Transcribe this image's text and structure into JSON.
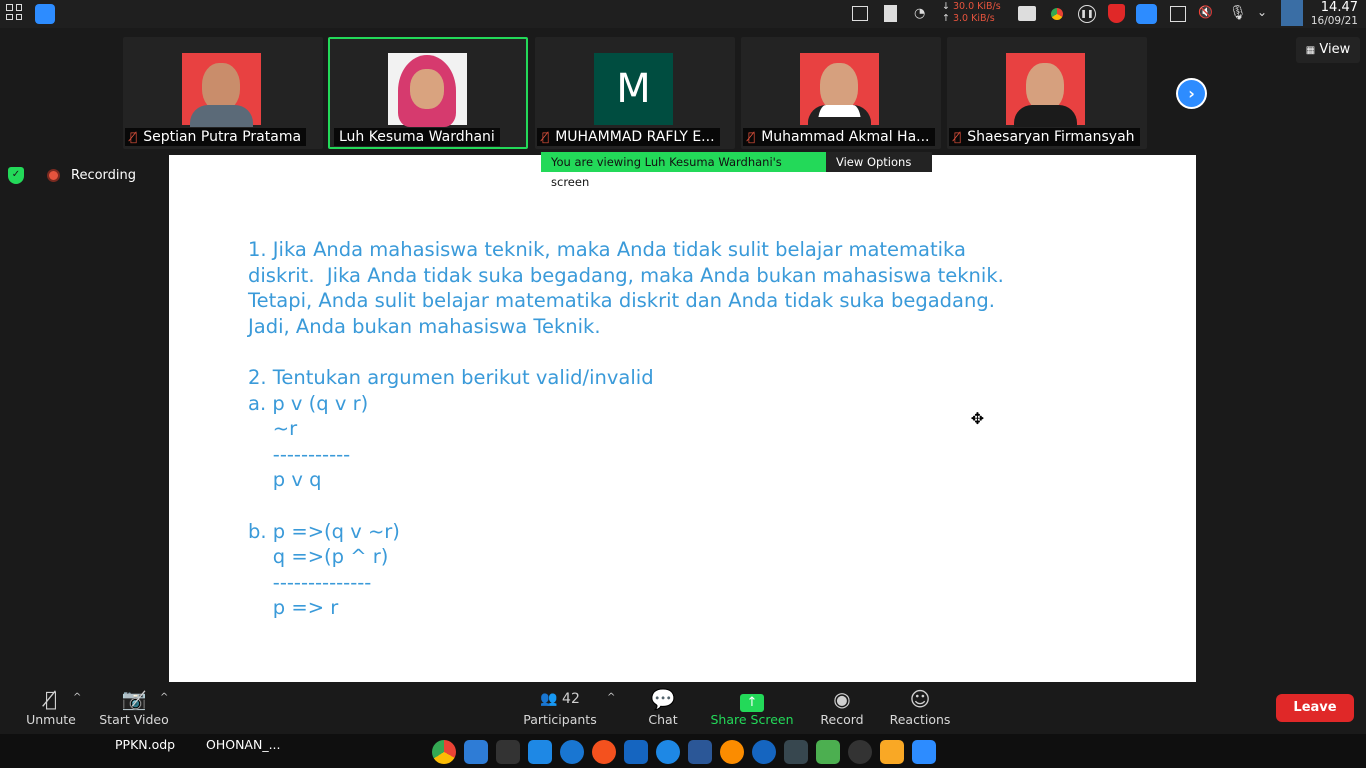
{
  "system": {
    "net_down": "30.0 KiB/s",
    "net_up": "3.0 KiB/s",
    "time": "14.47",
    "date": "16/09/21"
  },
  "participants": [
    {
      "name": "Septian Putra Pratama",
      "muted": true
    },
    {
      "name": "Luh Kesuma Wardhani",
      "muted": false
    },
    {
      "name": "MUHAMMAD RAFLY E...",
      "muted": true,
      "initial": "M"
    },
    {
      "name": "Muhammad Akmal Ha...",
      "muted": true
    },
    {
      "name": "Shaesaryan Firmansyah",
      "muted": true
    }
  ],
  "view_label": "View",
  "recording_label": "Recording",
  "share_banner": {
    "viewing": "You are viewing Luh Kesuma Wardhani's screen",
    "options": "View Options"
  },
  "slide": {
    "text": "1. Jika Anda mahasiswa teknik, maka Anda tidak sulit belajar matematika\ndiskrit.  Jika Anda tidak suka begadang, maka Anda bukan mahasiswa teknik.\nTetapi, Anda sulit belajar matematika diskrit dan Anda tidak suka begadang.\nJadi, Anda bukan mahasiswa Teknik.\n\n2. Tentukan argumen berikut valid/invalid\na. p v (q v r)\n    ~r\n    -----------\n    p v q\n\nb. p =>(q v ~r)\n    q =>(p ^ r)\n    --------------\n    p => r"
  },
  "toolbar": {
    "unmute": "Unmute",
    "start_video": "Start Video",
    "participants_count": "42",
    "participants": "Participants",
    "chat": "Chat",
    "share_screen": "Share Screen",
    "record": "Record",
    "reactions": "Reactions",
    "leave": "Leave"
  },
  "taskbar": {
    "item1": "PPKN.odp",
    "item2": "OHONAN_..."
  },
  "colors": {
    "accent_green": "#23d959",
    "zoom_blue": "#2d8cff",
    "leave_red": "#e02828",
    "slide_text": "#3a9ad9"
  }
}
